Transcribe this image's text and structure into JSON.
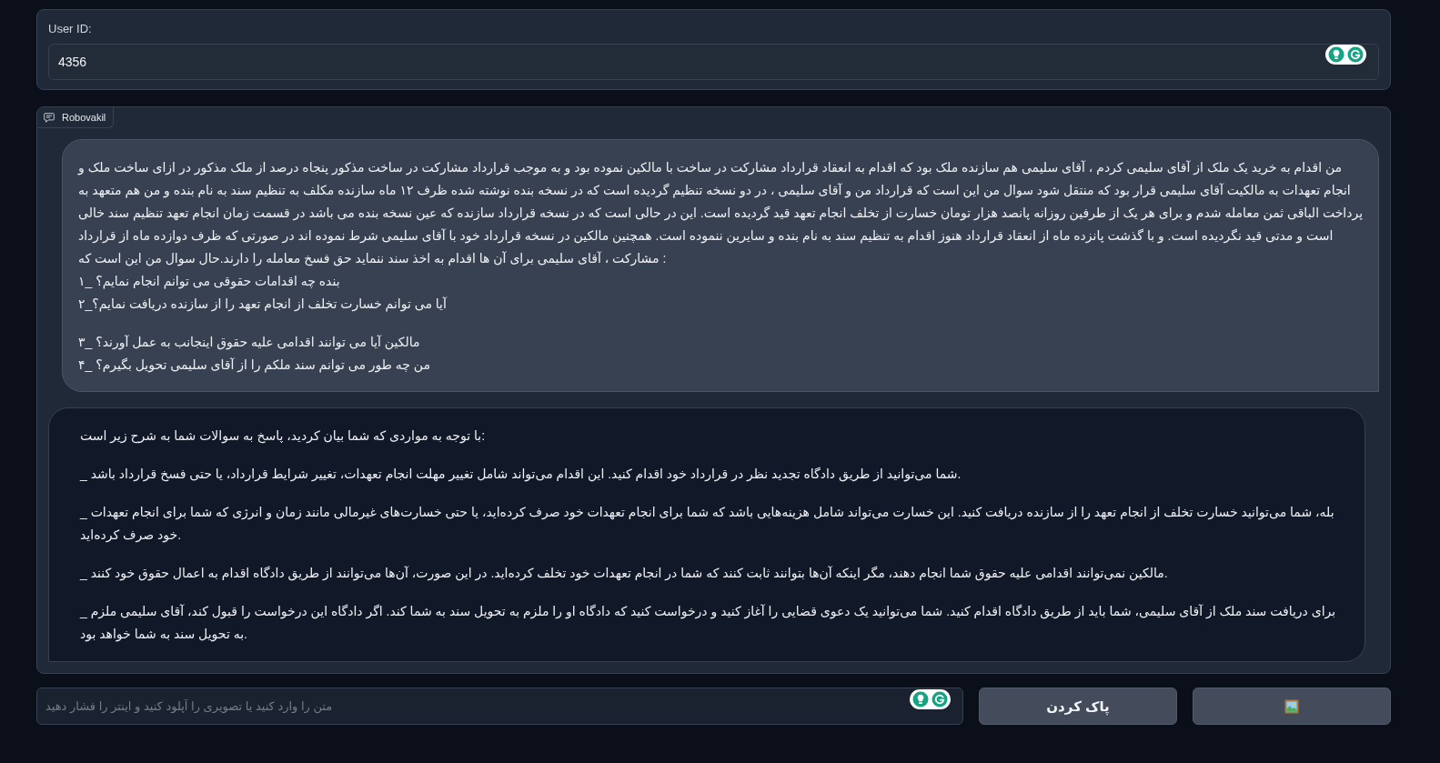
{
  "user_id_field": {
    "label": "User ID:",
    "value": "4356"
  },
  "chatbot": {
    "label": "Robovakil",
    "messages": [
      {
        "kind": "user",
        "paragraphs": [
          {
            "lines": [
              "من اقدام به خرید یک ملک از آقای سلیمی کردم ، آقای سلیمی هم سازنده ملک بود که اقدام به انعقاد قرارداد مشارکت در ساخت با مالکین نموده بود و به موجب قرارداد مشارکت در ساخت مذکور پنجاه درصد از ملک مذکور در ازای ساخت ملک و انجام تعهدات به مالکیت آقای سلیمی قرار بود که منتقل شود سوال من این است که قرارداد من و آقای سلیمی ، در دو نسخه تنظیم گردیده است که در نسخه بنده نوشته شده ظرف ۱۲ ماه سازنده مکلف به تنظیم سند به نام بنده و من هم متعهد به پرداخت الباقی ثمن معامله شدم و برای هر یک از طرفین روزانه پانصد هزار تومان خسارت از تخلف انجام تعهد قید گردیده است. این در حالی است که در نسخه قرارداد سازنده که عین نسخه بنده می باشد در قسمت زمان انجام تعهد تنظیم سند خالی است و مدتی قید نگردیده است. و با گذشت پانزده ماه از انعقاد قرارداد هنوز اقدام به تنظیم سند به نام بنده و سایرین ننموده است. همچنین مالکین در نسخه قرارداد خود با آقای سلیمی شرط نموده اند در صورتی که ظرف دوازده ماه از قرارداد مشارکت ، آقای سلیمی برای آن ها اقدام به اخذ سند ننماید حق فسخ معامله را دارند.حال سوال من این است که :",
              "۱_ بنده چه اقدامات حقوقی می توانم انجام نمایم؟",
              "۲_آیا می توانم خسارت تخلف از انجام تعهد را از سازنده دریافت نمایم؟"
            ]
          },
          {
            "lines": [
              "۳_ مالکین آیا می توانند اقدامی علیه حقوق اینجانب به عمل آورند؟",
              "۴_ من چه طور می توانم سند ملکم را از آقای سلیمی تحویل بگیرم؟"
            ]
          }
        ]
      },
      {
        "kind": "bot",
        "paragraphs": [
          {
            "lines": [
              "با توجه به مواردی که شما بیان کردید، پاسخ به سوالات شما به شرح زیر است:"
            ]
          },
          {
            "lines": [
              "_ شما می‌توانید از طریق دادگاه تجدید نظر در قرارداد خود اقدام کنید. این اقدام می‌تواند شامل تغییر مهلت انجام تعهدات، تغییر شرایط قرارداد، یا حتی فسخ قرارداد باشد."
            ]
          },
          {
            "lines": [
              "_ بله، شما می‌توانید خسارت تخلف از انجام تعهد را از سازنده دریافت کنید. این خسارت می‌تواند شامل هزینه‌هایی باشد که شما برای انجام تعهدات خود صرف کرده‌اید، یا حتی خسارت‌های غیرمالی مانند زمان و انرژی که شما برای انجام تعهدات خود صرف کرده‌اید."
            ]
          },
          {
            "lines": [
              "_ مالکین نمی‌توانند اقدامی علیه حقوق شما انجام دهند، مگر اینکه آن‌ها بتوانند ثابت کنند که شما در انجام تعهدات خود تخلف کرده‌اید. در این صورت، آن‌ها می‌توانند از طریق دادگاه اقدام به اعمال حقوق خود کنند."
            ]
          },
          {
            "lines": [
              "_ برای دریافت سند ملک از آقای سلیمی، شما باید از طریق دادگاه اقدام کنید. شما می‌توانید یک دعوی قضایی را آغاز کنید و درخواست کنید که دادگاه او را ملزم به تحویل سند به شما کند. اگر دادگاه این درخواست را قبول کند، آقای سلیمی ملزم به تحویل سند به شما خواهد بود."
            ]
          }
        ]
      }
    ]
  },
  "message_input": {
    "placeholder": "متن را وارد کنید یا تصویری را آپلود کنید و اینتر را فشار دهید"
  },
  "buttons": [
    {
      "kind": "text",
      "label": "پاک کردن"
    },
    {
      "kind": "image"
    }
  ]
}
